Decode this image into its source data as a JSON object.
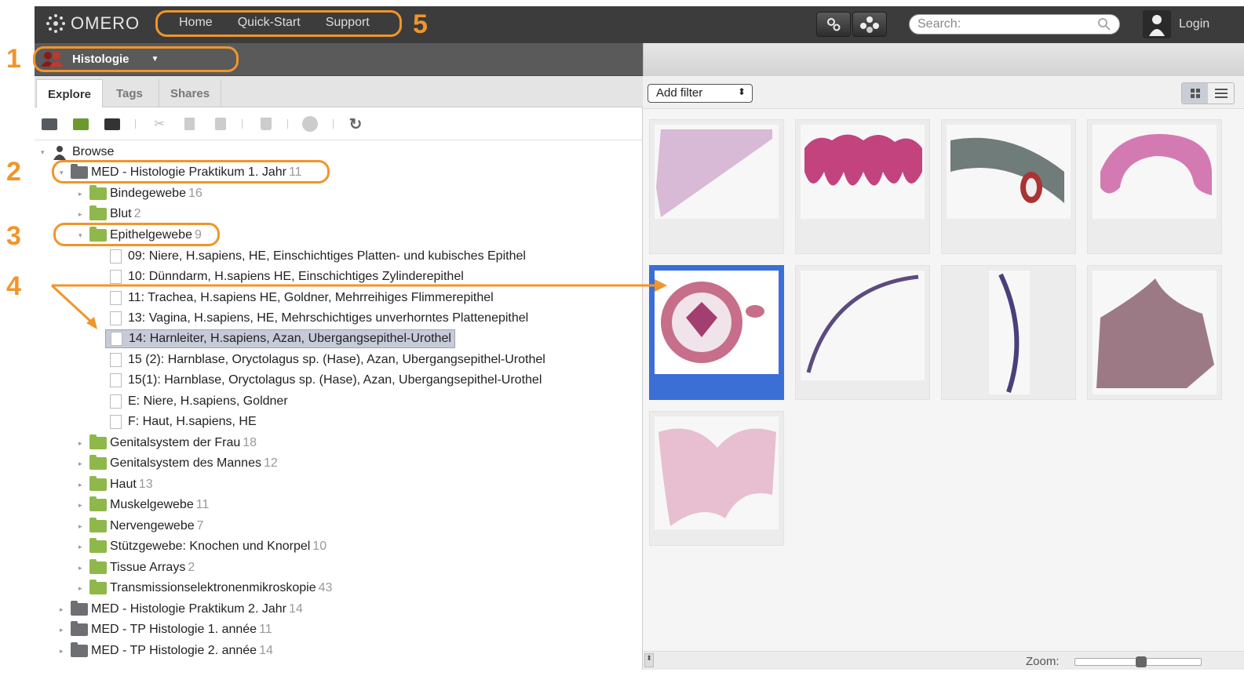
{
  "app": {
    "logo_text": "OMERO",
    "nav": [
      "Home",
      "Quick-Start",
      "Support"
    ],
    "search_placeholder": "Search:",
    "login_label": "Login"
  },
  "group": {
    "name": "Histologie"
  },
  "tabs": [
    "Explore",
    "Tags",
    "Shares"
  ],
  "tree": {
    "root": "Browse",
    "project1": {
      "name": "MED - Histologie Praktikum 1. Jahr",
      "count": "11"
    },
    "datasets_before": [
      {
        "name": "Bindegewebe",
        "count": "16"
      },
      {
        "name": "Blut",
        "count": "2"
      }
    ],
    "expanded_dataset": {
      "name": "Epithelgewebe",
      "count": "9"
    },
    "images": [
      "09: Niere, H.sapiens, HE, Einschichtiges Platten- und kubisches Epithel",
      "10: Dünndarm, H.sapiens HE, Einschichtiges Zylinderepithel",
      "11: Trachea, H.sapiens HE, Goldner, Mehrreihiges Flimmerepithel",
      "13: Vagina, H.sapiens, HE, Mehrschichtiges unverhorntes Plattenepithel",
      "14: Harnleiter, H.sapiens, Azan, Ubergangsepithel-Urothel",
      "15 (2): Harnblase, Oryctolagus sp. (Hase), Azan, Ubergangsepithel-Urothel",
      "15(1): Harnblase, Oryctolagus sp. (Hase), Azan, Ubergangsepithel-Urothel",
      "E: Niere, H.sapiens, Goldner",
      "F: Haut, H.sapiens, HE"
    ],
    "datasets_after": [
      {
        "name": "Genitalsystem der Frau",
        "count": "18"
      },
      {
        "name": "Genitalsystem des Mannes",
        "count": "12"
      },
      {
        "name": "Haut",
        "count": "13"
      },
      {
        "name": "Muskelgewebe",
        "count": "11"
      },
      {
        "name": "Nervengewebe",
        "count": "7"
      },
      {
        "name": "Stützgewebe: Knochen und Knorpel",
        "count": "10"
      },
      {
        "name": "Tissue Arrays",
        "count": "2"
      },
      {
        "name": "Transmissionselektronenmikroskopie",
        "count": "43"
      }
    ],
    "projects_after": [
      {
        "name": "MED - Histologie Praktikum 2. Jahr",
        "count": "14"
      },
      {
        "name": "MED - TP Histologie 1. année",
        "count": "11"
      },
      {
        "name": "MED - TP Histologie 2. année",
        "count": "14"
      }
    ]
  },
  "right": {
    "add_filter_label": "Add filter",
    "zoom_label": "Zoom:",
    "zoom_fraction": 0.52
  },
  "annotations": [
    "1",
    "2",
    "3",
    "4",
    "5"
  ],
  "colors": {
    "accent": "#f0952b",
    "selection": "#3b6fd6"
  }
}
